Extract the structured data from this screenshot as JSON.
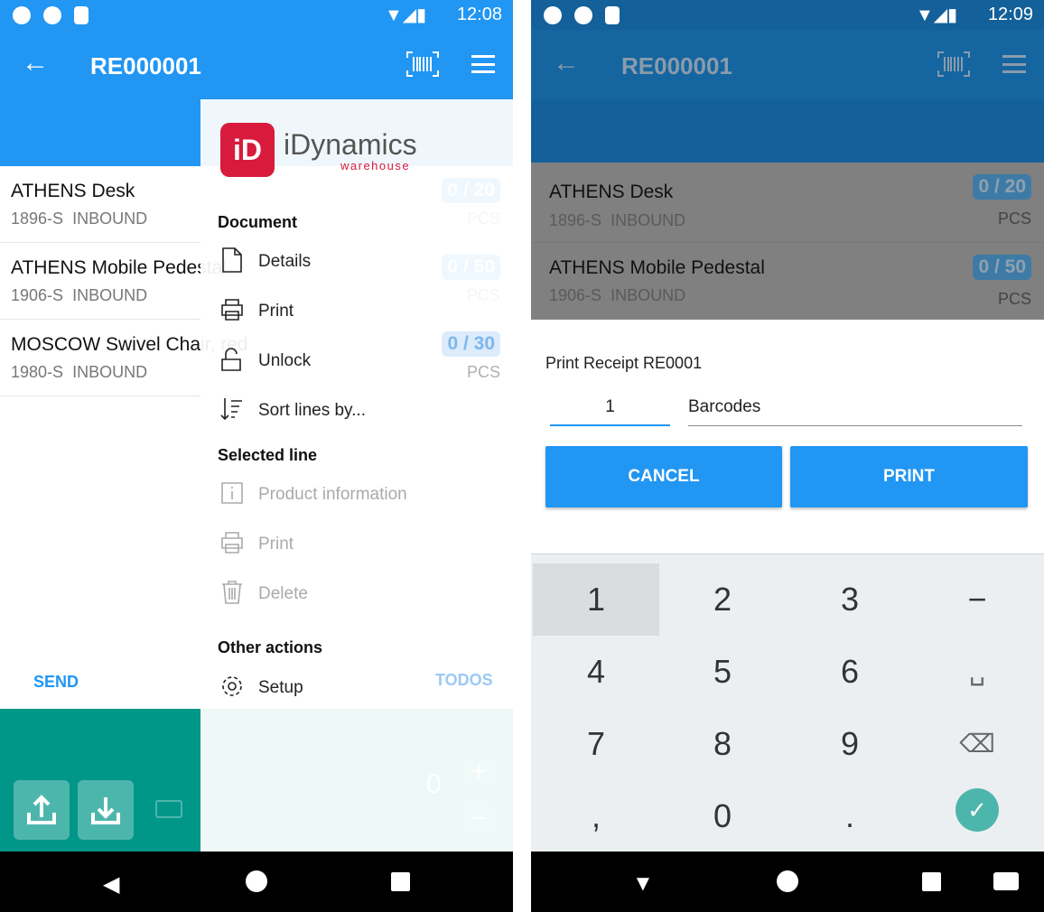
{
  "left": {
    "status_time": "12:08",
    "title": "RE000001",
    "lines": [
      {
        "name": "ATHENS Desk",
        "code": "1896-S",
        "location": "INBOUND",
        "qty": "0 / 20",
        "unit": "PCS"
      },
      {
        "name": "ATHENS Mobile Pedestal",
        "code": "1906-S",
        "location": "INBOUND",
        "qty": "0 / 50",
        "unit": "PCS"
      },
      {
        "name": "MOSCOW Swivel Chair, red",
        "code": "1980-S",
        "location": "INBOUND",
        "qty": "0 / 30",
        "unit": "PCS"
      }
    ],
    "send_label": "SEND",
    "todos_label": "TODOS",
    "counter_value": "0",
    "drawer": {
      "logo_text": "iDynamics",
      "logo_sub": "warehouse",
      "logo_mark": "iD",
      "sections": [
        {
          "title": "Document",
          "items": [
            "Details",
            "Print",
            "Unlock",
            "Sort lines by..."
          ]
        },
        {
          "title": "Selected line",
          "items": [
            "Product information",
            "Print",
            "Delete"
          ]
        },
        {
          "title": "Other actions",
          "items": [
            "Setup"
          ]
        }
      ]
    }
  },
  "right": {
    "status_time": "12:09",
    "title": "RE000001",
    "dialog": {
      "title": "Print Receipt RE0001",
      "copies": "1",
      "label_type": "Barcodes",
      "cancel": "CANCEL",
      "print": "PRINT"
    },
    "keypad": [
      "1",
      "2",
      "3",
      "−",
      "4",
      "5",
      "6",
      "␣",
      "7",
      "8",
      "9",
      "⌫",
      ",",
      "0",
      ".",
      "✓"
    ]
  },
  "colors": {
    "primary": "#2196f3",
    "teal": "#009688",
    "brand_red": "#d81b3c"
  }
}
